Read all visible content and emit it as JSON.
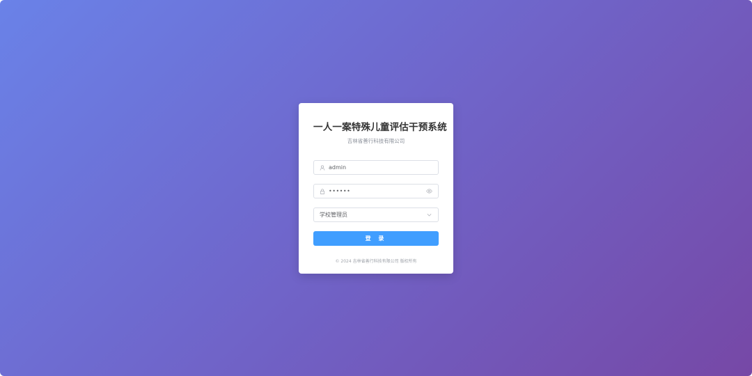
{
  "login": {
    "title": "一人一案特殊儿童评估干预系统",
    "subtitle": "吉林省善行科技有限公司",
    "username": {
      "value": "admin",
      "icon": "user-icon"
    },
    "password": {
      "value": "••••••",
      "icon": "lock-icon",
      "toggle_icon": "eye-icon"
    },
    "role": {
      "selected": "学校管理员",
      "icon": "chevron-down-icon"
    },
    "submit_label": "登 录",
    "footer": "© 2024 吉林省善行科技有限公司 版权所有"
  },
  "colors": {
    "gradient_start": "#6a82e8",
    "gradient_end": "#7648a6",
    "button": "#409eff",
    "title": "#333333"
  }
}
